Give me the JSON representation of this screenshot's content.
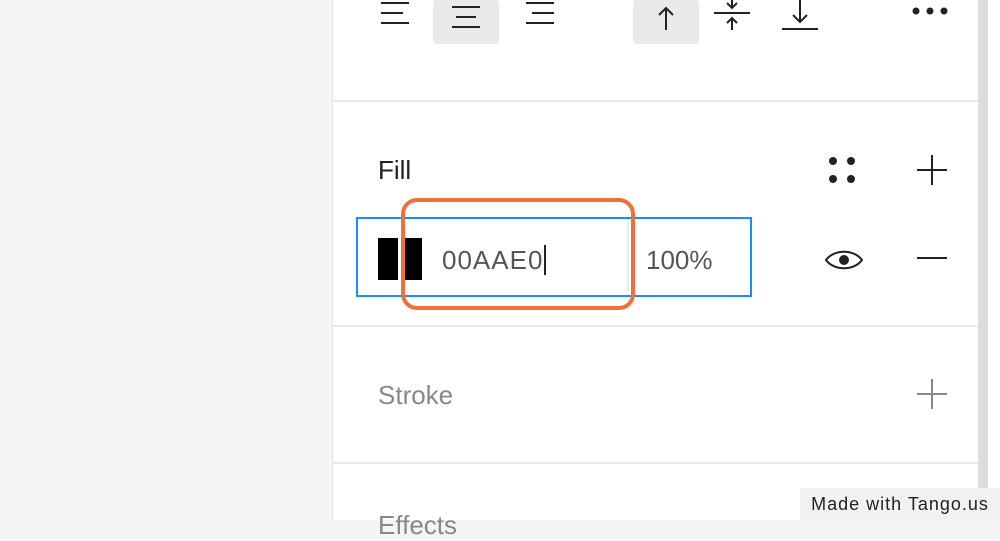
{
  "toolbar": {
    "icons": [
      "align-left-icon",
      "align-center-icon",
      "align-right-icon",
      "align-top-icon",
      "align-middle-icon",
      "align-bottom-icon",
      "more-icon"
    ]
  },
  "fill": {
    "title": "Fill",
    "swatch_color": "#000000",
    "hex_value": "00AAE0",
    "opacity": "100%"
  },
  "stroke": {
    "title": "Stroke"
  },
  "effects": {
    "title": "Effects"
  },
  "colors": {
    "accent": "#1a8cff",
    "highlight": "#f0703c"
  },
  "watermark": "Made with Tango.us"
}
